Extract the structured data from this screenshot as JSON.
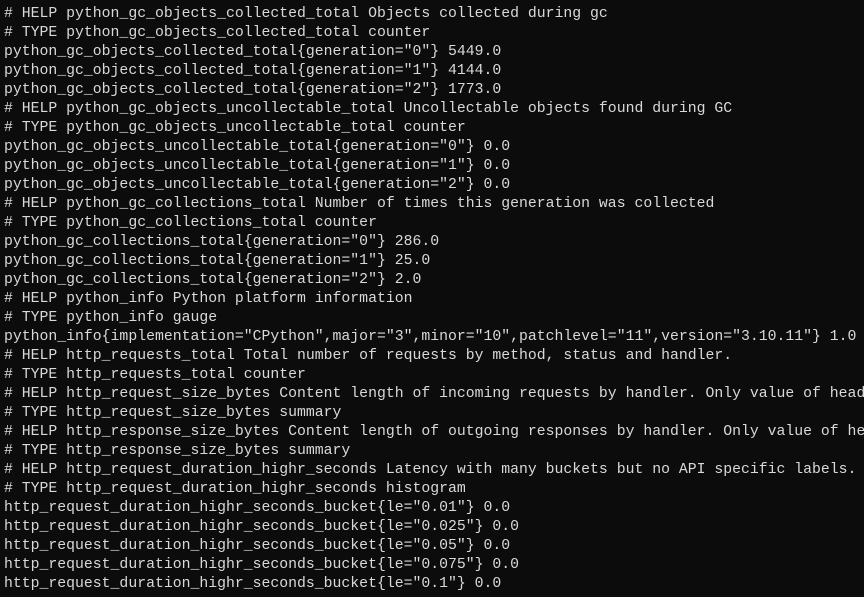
{
  "background_color": "#0c0c0c",
  "text_color": "#d9d9d9",
  "lines": [
    "# HELP python_gc_objects_collected_total Objects collected during gc",
    "# TYPE python_gc_objects_collected_total counter",
    "python_gc_objects_collected_total{generation=\"0\"} 5449.0",
    "python_gc_objects_collected_total{generation=\"1\"} 4144.0",
    "python_gc_objects_collected_total{generation=\"2\"} 1773.0",
    "# HELP python_gc_objects_uncollectable_total Uncollectable objects found during GC",
    "# TYPE python_gc_objects_uncollectable_total counter",
    "python_gc_objects_uncollectable_total{generation=\"0\"} 0.0",
    "python_gc_objects_uncollectable_total{generation=\"1\"} 0.0",
    "python_gc_objects_uncollectable_total{generation=\"2\"} 0.0",
    "# HELP python_gc_collections_total Number of times this generation was collected",
    "# TYPE python_gc_collections_total counter",
    "python_gc_collections_total{generation=\"0\"} 286.0",
    "python_gc_collections_total{generation=\"1\"} 25.0",
    "python_gc_collections_total{generation=\"2\"} 2.0",
    "# HELP python_info Python platform information",
    "# TYPE python_info gauge",
    "python_info{implementation=\"CPython\",major=\"3\",minor=\"10\",patchlevel=\"11\",version=\"3.10.11\"} 1.0",
    "# HELP http_requests_total Total number of requests by method, status and handler.",
    "# TYPE http_requests_total counter",
    "# HELP http_request_size_bytes Content length of incoming requests by handler. Only value of head",
    "# TYPE http_request_size_bytes summary",
    "# HELP http_response_size_bytes Content length of outgoing responses by handler. Only value of he",
    "# TYPE http_response_size_bytes summary",
    "# HELP http_request_duration_highr_seconds Latency with many buckets but no API specific labels.",
    "# TYPE http_request_duration_highr_seconds histogram",
    "http_request_duration_highr_seconds_bucket{le=\"0.01\"} 0.0",
    "http_request_duration_highr_seconds_bucket{le=\"0.025\"} 0.0",
    "http_request_duration_highr_seconds_bucket{le=\"0.05\"} 0.0",
    "http_request_duration_highr_seconds_bucket{le=\"0.075\"} 0.0",
    "http_request_duration_highr_seconds_bucket{le=\"0.1\"} 0.0"
  ]
}
